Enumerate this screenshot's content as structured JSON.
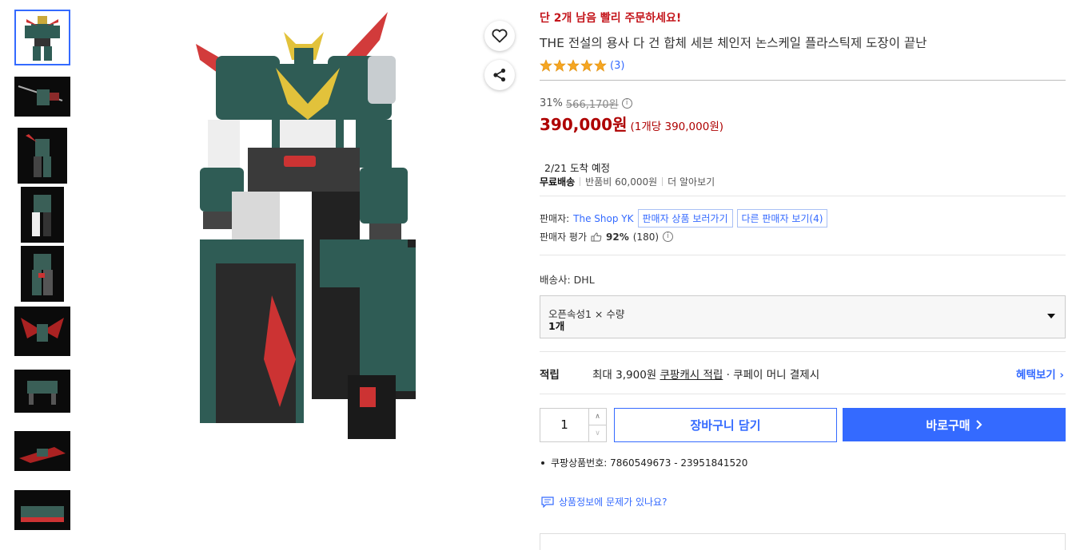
{
  "product": {
    "urgency": "단 2개 남음 빨리 주문하세요!",
    "title": "THE 전설의 용사 다 건 합체 세븐 체인저 논스케일 플라스틱제 도장이 끝난",
    "rating": {
      "stars": 5,
      "count": "(3)"
    },
    "discount_rate": "31%",
    "original_price": "566,170원",
    "price": "390,000원",
    "unit_price": "(1개당 390,000원)",
    "arrival": "2/21 도착 예정",
    "shipping": {
      "label": "무료배송",
      "return_fee": "반품비 60,000원",
      "more": "더 알아보기"
    },
    "seller": {
      "label": "판매자:",
      "name": "The Shop YK",
      "view_products": "판매자 상품 보러가기",
      "other_sellers": "다른 판매자 보기(4)",
      "eval_label": "판매자 평가",
      "eval_percent": "92%",
      "eval_count": "(180)"
    },
    "carrier": "배송사:  DHL",
    "option": {
      "name": "오픈속성1 × 수량",
      "value": "1개"
    },
    "reward": {
      "label": "적립",
      "text_pre": "최대 3,900원 ",
      "text_link": "쿠팡캐시 적립",
      "text_post": " · 쿠페이 머니 결제시",
      "benefit": "혜택보기 ›"
    },
    "quantity": "1",
    "cart_button": "장바구니 담기",
    "buy_button": "바로구매",
    "product_number": "쿠팡상품번호: 7860549673 - 23951841520",
    "report": "상품정보에 문제가 있나요?"
  },
  "colors": {
    "accent": "#346aff",
    "price_red": "#ae0000",
    "urgent_red": "#c4161c",
    "star": "#f5a623"
  },
  "thumbnails": [
    "robot-front",
    "robot-sword",
    "robot-side",
    "robot-back",
    "robot-pose",
    "jet-mode",
    "beast-mode",
    "vehicle-red",
    "vehicle-green"
  ]
}
